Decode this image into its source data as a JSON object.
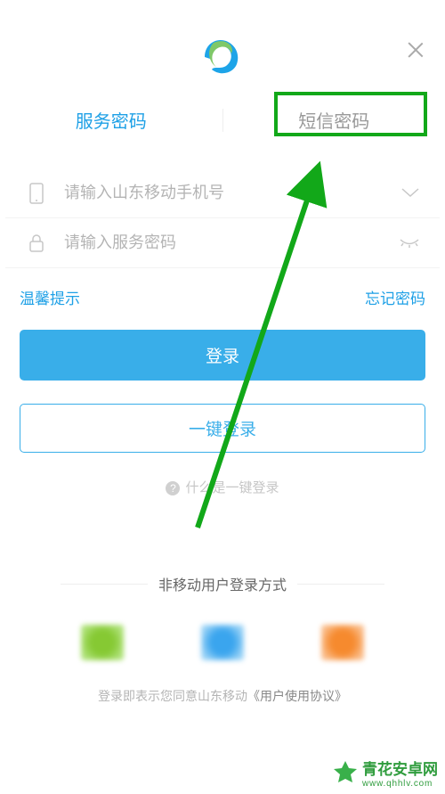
{
  "tabs": {
    "service": "服务密码",
    "sms": "短信密码"
  },
  "inputs": {
    "phone_placeholder": "请输入山东移动手机号",
    "password_placeholder": "请输入服务密码"
  },
  "links": {
    "warm_tip": "温馨提示",
    "forgot": "忘记密码"
  },
  "buttons": {
    "login": "登录",
    "onekey": "一键登录"
  },
  "help": "什么是一键登录",
  "alt_login_title": "非移动用户登录方式",
  "agreement_prefix": "登录即表示您同意山东移动",
  "agreement_link": "《用户使用协议》",
  "watermark": {
    "title": "青花安卓网",
    "url": "www.qhhlv.com"
  }
}
